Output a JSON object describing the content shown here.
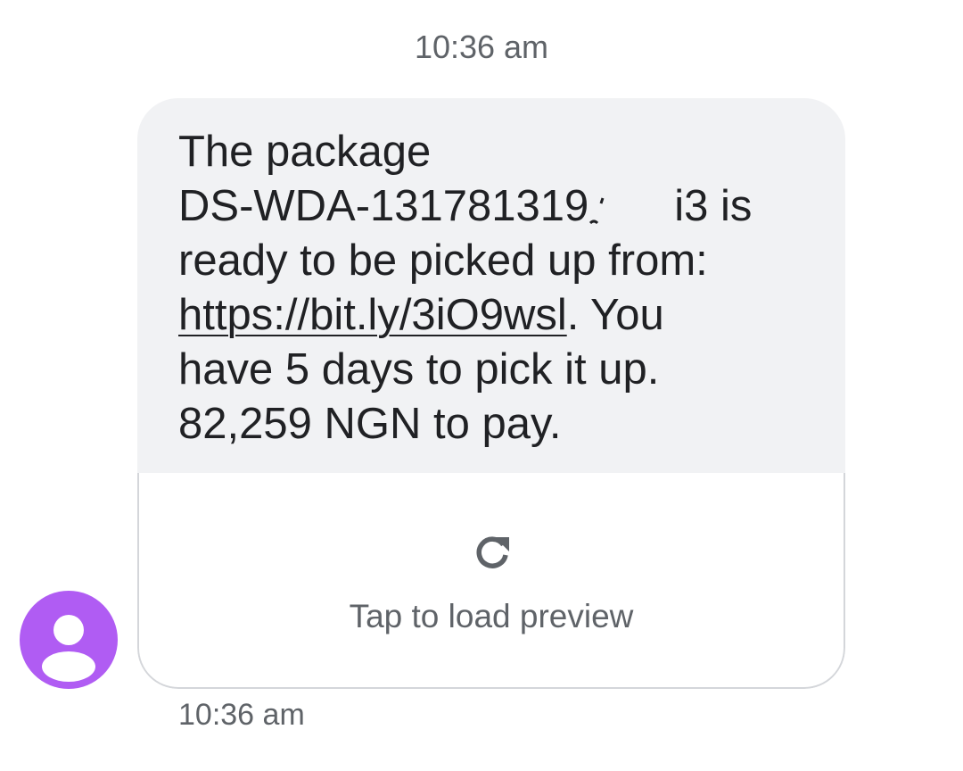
{
  "conversation": {
    "timestamp_top": "10:36 am",
    "timestamp_bottom": "10:36 am"
  },
  "message": {
    "line1": "The package",
    "line2_prefix": "DS-WDA-131781319",
    "line2_suffix": "i3 is",
    "line3": "ready to be picked up from:",
    "link_text": "https://bit.ly/3iO9wsl",
    "line4_suffix": ". You",
    "line5": "have 5 days to pick it up.",
    "line6": "82,259 NGN to pay."
  },
  "preview": {
    "icon": "refresh-icon",
    "label": "Tap to load preview"
  },
  "avatar": {
    "icon": "person-icon",
    "color": "#b05cf3"
  },
  "colors": {
    "bubble_bg": "#f1f2f4",
    "text": "#202124",
    "secondary_text": "#5f6368"
  }
}
